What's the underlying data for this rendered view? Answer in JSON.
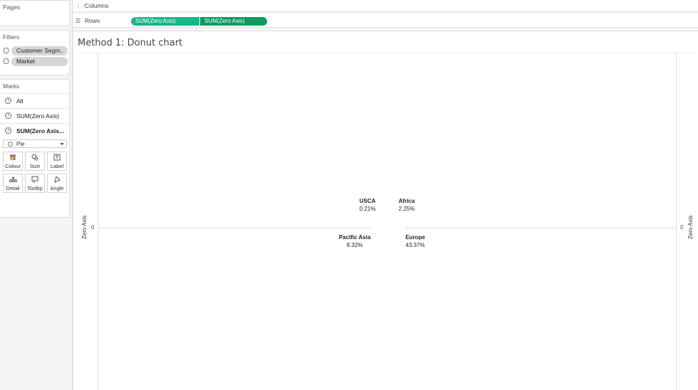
{
  "pages": {
    "title": "Pages"
  },
  "filters": {
    "title": "Filters",
    "items": [
      {
        "label": "Customer Segm.."
      },
      {
        "label": "Market"
      }
    ]
  },
  "marks": {
    "title": "Marks",
    "rows": [
      {
        "label": "All"
      },
      {
        "label": "SUM(Zero Axis)"
      },
      {
        "label": "SUM(Zero Axis..."
      }
    ],
    "mark_type": "Pie",
    "buttons": [
      {
        "label": "Colour",
        "icon": "colour-icon"
      },
      {
        "label": "Size",
        "icon": "size-icon"
      },
      {
        "label": "Label",
        "icon": "label-icon"
      },
      {
        "label": "Detail",
        "icon": "detail-icon"
      },
      {
        "label": "Tooltip",
        "icon": "tooltip-icon"
      },
      {
        "label": "Angle",
        "icon": "angle-icon"
      }
    ]
  },
  "shelves": {
    "columns_label": "Columns",
    "rows_label": "Rows",
    "row_pills": [
      {
        "label": "SUM(Zero Axis)",
        "color": "#18b688"
      },
      {
        "label": "SUM(Zero Axis)",
        "color": "#0f9a5e"
      }
    ]
  },
  "worksheet": {
    "title": "Method 1: Donut chart",
    "left_axis_label": "Zero Axis",
    "right_axis_label": "Zero Axis",
    "left_zero": "0",
    "right_zero": "0",
    "data_labels": [
      {
        "name": "USCA",
        "value": "0.21%"
      },
      {
        "name": "Africa",
        "value": "2.25%"
      },
      {
        "name": "Pacific Asia",
        "value": "8.32%"
      },
      {
        "name": "Europe",
        "value": "43.37%"
      }
    ]
  }
}
